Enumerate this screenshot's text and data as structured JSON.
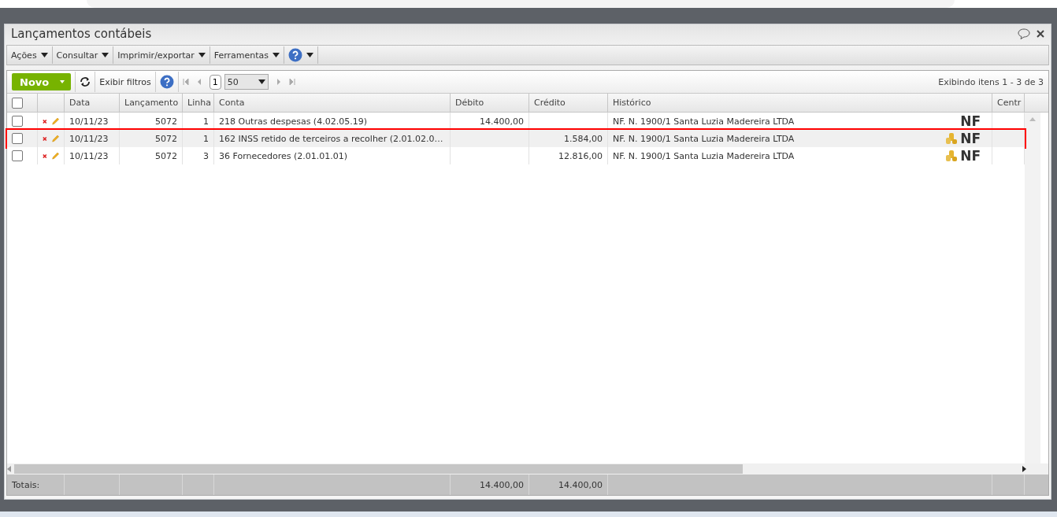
{
  "window": {
    "title": "Lançamentos contábeis"
  },
  "menu": [
    {
      "label": "Ações"
    },
    {
      "label": "Consultar"
    },
    {
      "label": "Imprimir/exportar"
    },
    {
      "label": "Ferramentas"
    }
  ],
  "toolbar": {
    "new_button": "Novo",
    "filters_button": "Exibir filtros",
    "page": "1",
    "page_size": "50",
    "status": "Exibindo itens 1 - 3 de 3"
  },
  "table": {
    "all_checked": false,
    "columns": [
      "Data",
      "Lançamento",
      "Linha",
      "Conta",
      "Débito",
      "Crédito",
      "Histórico",
      "Centr"
    ],
    "rows": [
      {
        "checked": false,
        "selected": false,
        "highlighted": false,
        "data": "10/11/23",
        "lancamento": "5072",
        "linha": "1",
        "conta": "218 Outras despesas (4.02.05.19)",
        "debito": "14.400,00",
        "credito": "",
        "historico": "NF. N. 1900/1 Santa Luzia Madereira LTDA",
        "coins": false,
        "badge": "NF"
      },
      {
        "checked": false,
        "selected": true,
        "highlighted": true,
        "data": "10/11/23",
        "lancamento": "5072",
        "linha": "1",
        "conta": "162 INSS retido de terceiros a recolher (2.01.02.0…",
        "debito": "",
        "credito": "1.584,00",
        "historico": "NF. N. 1900/1 Santa Luzia Madereira LTDA",
        "coins": true,
        "badge": "NF"
      },
      {
        "checked": false,
        "selected": false,
        "highlighted": false,
        "data": "10/11/23",
        "lancamento": "5072",
        "linha": "3",
        "conta": "36 Fornecedores (2.01.01.01)",
        "debito": "",
        "credito": "12.816,00",
        "historico": "NF. N. 1900/1 Santa Luzia Madereira LTDA",
        "coins": true,
        "badge": "NF"
      }
    ],
    "totals": {
      "label": "Totais:",
      "debito": "14.400,00",
      "credito": "14.400,00"
    }
  }
}
